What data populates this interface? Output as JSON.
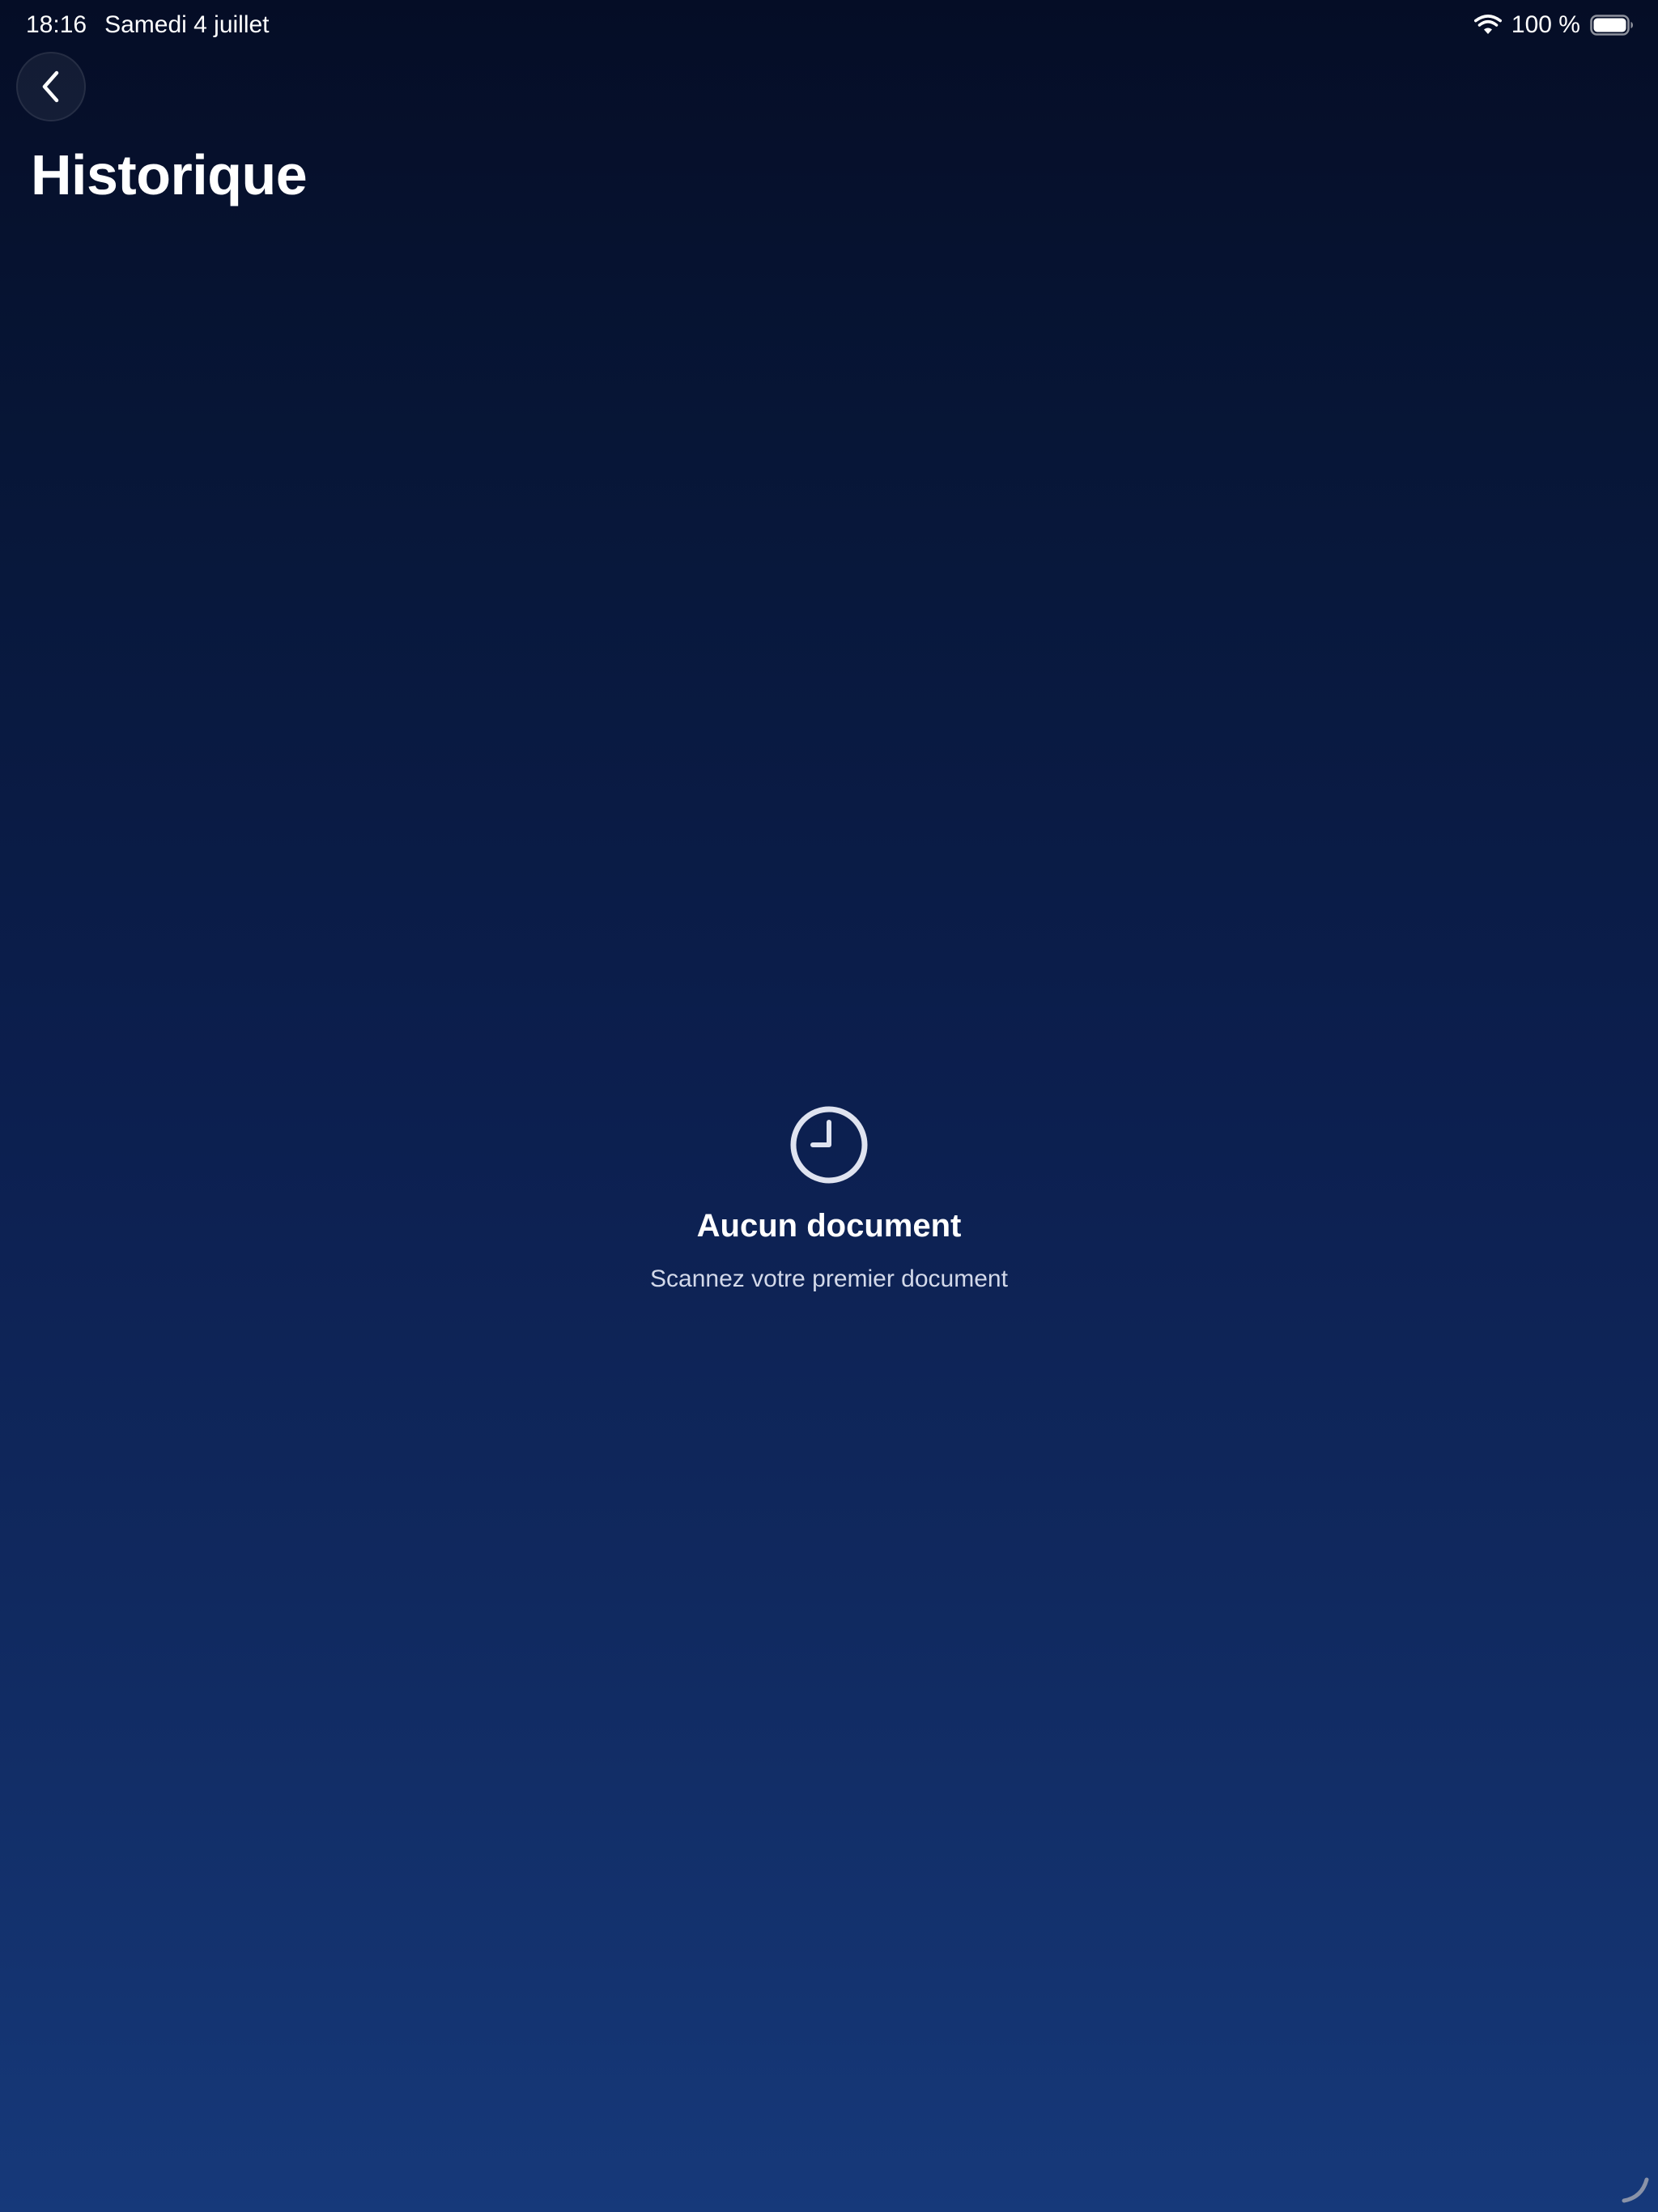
{
  "status_bar": {
    "time": "18:16",
    "date": "Samedi 4 juillet",
    "battery_text": "100 %",
    "wifi_icon": "wifi-icon",
    "battery_icon": "battery-icon",
    "battery_level": 1.0
  },
  "header": {
    "back_icon": "chevron-left-icon",
    "title": "Historique"
  },
  "empty_state": {
    "icon": "clock-icon",
    "title": "Aucun document",
    "subtitle": "Scannez votre premier document"
  },
  "colors": {
    "background_top": "#050d26",
    "background_bottom": "#16397a",
    "text_primary": "#ffffff",
    "text_secondary": "#d3d9ea",
    "icon": "#dfe3f0"
  }
}
